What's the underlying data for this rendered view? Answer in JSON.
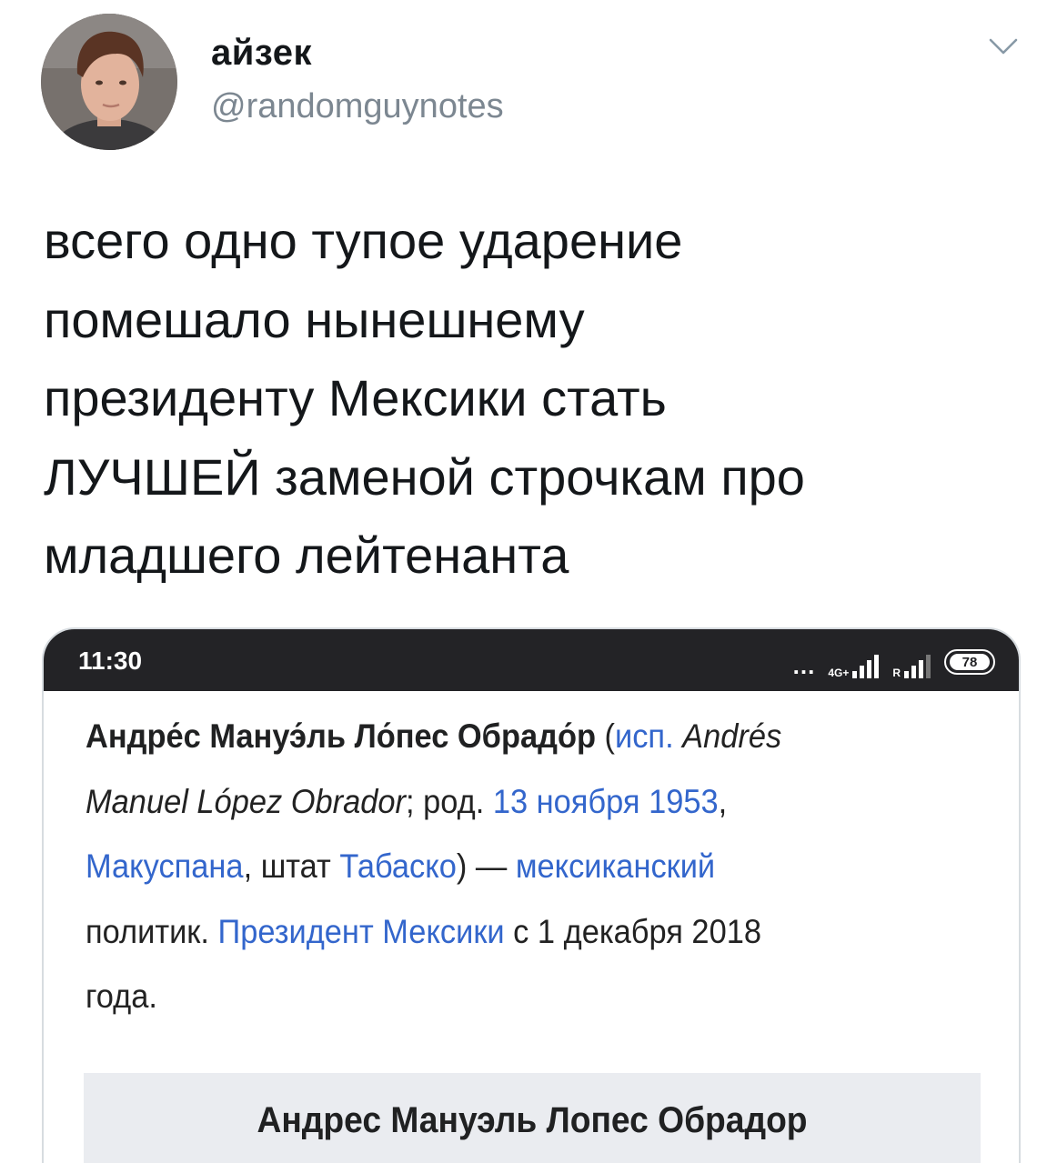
{
  "author": {
    "display_name": "айзек",
    "handle": "@randomguynotes",
    "avatar_icon": "user-avatar-photo",
    "menu_icon": "chevron-down-icon"
  },
  "tweet": {
    "lines": [
      "всего одно тупое ударение",
      "помешало нынешнему",
      "президенту Мексики стать",
      "ЛУЧШЕЙ заменой строчкам про",
      "младшего лейтенанта"
    ]
  },
  "screenshot": {
    "status_bar": {
      "time": "11:30",
      "dots": "...",
      "network_label": "4G+",
      "roaming_label": "R",
      "battery": "78"
    },
    "article": {
      "l1_bold": "Андре́с Мануэ́ль Ло́пес Обрадо́р",
      "l1_paren": " (",
      "l1_link": "исп.",
      "l1_italic": " Andrés",
      "l2_italic": "Manuel López Obrador",
      "l2_text": "; род. ",
      "l2_link": "13 ноября 1953",
      "l2_comma": ",",
      "l3_link1": "Макуспана",
      "l3_text1": ", штат ",
      "l3_link2": "Табаско",
      "l3_text2": ") — ",
      "l3_link3": "мексиканский",
      "l4_text1": "политик. ",
      "l4_link": "Президент Мексики",
      "l4_text2": " с 1 декабря 2018",
      "l5_text": "года."
    },
    "infobox_title": "Андрес Мануэль Лопес Обрадор"
  },
  "colors": {
    "link": "#3366cc",
    "handle": "#7c8791",
    "status_bar": "#232326",
    "infobox_bg": "#eaecf0"
  }
}
